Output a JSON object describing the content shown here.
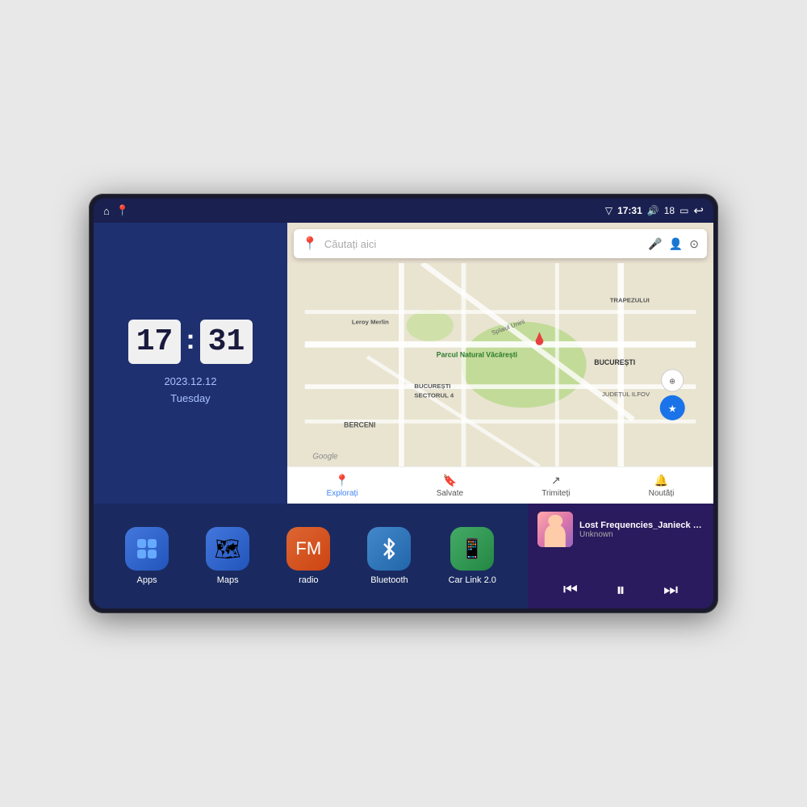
{
  "device": {
    "status_bar": {
      "signal_icon": "▽",
      "time": "17:31",
      "volume_icon": "🔊",
      "battery_level": "18",
      "battery_icon": "▭",
      "back_icon": "↩"
    },
    "home_icon": "⌂",
    "maps_shortcut_icon": "📍"
  },
  "clock": {
    "hours": "17",
    "minutes": "31",
    "date": "2023.12.12",
    "day": "Tuesday"
  },
  "map": {
    "search_placeholder": "Căutați aici",
    "labels": {
      "park": "Parcul Natural Văcărești",
      "leroy": "Leroy Merlin",
      "sector": "BUCUREȘTI\nSECTORUL 4",
      "berceni": "BERCENI",
      "trapezului": "TRAPEZULUI",
      "bucuresti": "BUCUREȘTI",
      "ilfov": "JUDEȚUL ILFOV",
      "splaiul": "Splaiul Unirii"
    },
    "nav_items": [
      {
        "icon": "📍",
        "label": "Explorați",
        "active": true
      },
      {
        "icon": "🔖",
        "label": "Salvate",
        "active": false
      },
      {
        "icon": "↗",
        "label": "Trimiteți",
        "active": false
      },
      {
        "icon": "🔔",
        "label": "Noutăți",
        "active": false
      }
    ]
  },
  "apps": [
    {
      "name": "Apps",
      "icon": "⊞",
      "bg_color": "#3366cc"
    },
    {
      "name": "Maps",
      "icon": "🗺",
      "bg_color": "#3366cc"
    },
    {
      "name": "radio",
      "icon": "📻",
      "bg_color": "#e05020"
    },
    {
      "name": "Bluetooth",
      "icon": "⚡",
      "bg_color": "#4488cc"
    },
    {
      "name": "Car Link 2.0",
      "icon": "📱",
      "bg_color": "#44aa66"
    }
  ],
  "music": {
    "title": "Lost Frequencies_Janieck Devy-...",
    "artist": "Unknown",
    "prev_icon": "⏮",
    "play_icon": "⏸",
    "next_icon": "⏭"
  }
}
